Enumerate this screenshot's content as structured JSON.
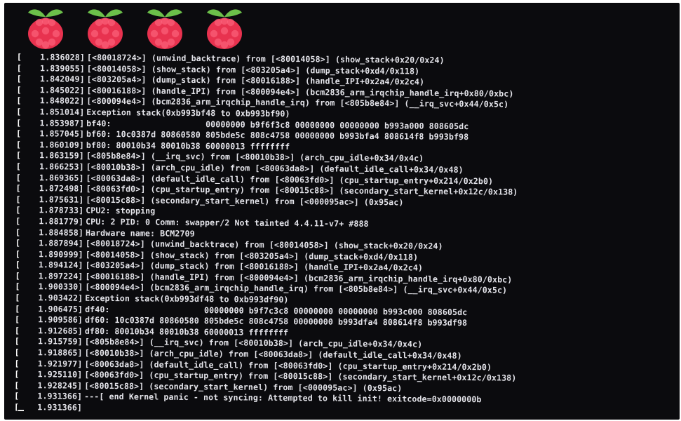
{
  "screen": {
    "background": "#0b0b0e",
    "text_color": "#e4e4ea",
    "logo_icon": "raspberry-pi-logo-icon",
    "logo_count": 4,
    "logo_colors": {
      "berry": "#e8324f",
      "leaf": "#6cc04a"
    }
  },
  "console": {
    "lines": [
      {
        "bracket": "[",
        "ts": "1.836028]",
        "msg": "[<80018724>] (unwind_backtrace) from [<80014058>] (show_stack+0x20/0x24)"
      },
      {
        "bracket": "[",
        "ts": "1.839055]",
        "msg": "[<80014058>] (show_stack) from [<803205a4>] (dump_stack+0xd4/0x118)"
      },
      {
        "bracket": "[",
        "ts": "1.842049]",
        "msg": "[<803205a4>] (dump_stack) from [<80016188>] (handle_IPI+0x2a4/0x2c4)"
      },
      {
        "bracket": "[",
        "ts": "1.845022]",
        "msg": "[<80016188>] (handle_IPI) from [<800094e4>] (bcm2836_arm_irqchip_handle_irq+0x80/0xbc)"
      },
      {
        "bracket": "[",
        "ts": "1.848022]",
        "msg": "[<800094e4>] (bcm2836_arm_irqchip_handle_irq) from [<805b8e84>] (__irq_svc+0x44/0x5c)"
      },
      {
        "bracket": "[",
        "ts": "1.851014]",
        "msg": "Exception stack(0xb993bf48 to 0xb993bf90)"
      },
      {
        "bracket": "[",
        "ts": "1.853987]",
        "msg": "bf40:                   00000000 b9f6f3c8 00000000 00000000 b993a000 808605dc"
      },
      {
        "bracket": "[",
        "ts": "1.857045]",
        "msg": "bf60: 10c0387d 80860580 805bde5c 808c4758 00000000 b993bfa4 808614f8 b993bf98"
      },
      {
        "bracket": "[",
        "ts": "1.860109]",
        "msg": "bf80: 80010b34 80010b38 60000013 ffffffff"
      },
      {
        "bracket": "[",
        "ts": "1.863159]",
        "msg": "[<805b8e84>] (__irq_svc) from [<80010b38>] (arch_cpu_idle+0x34/0x4c)"
      },
      {
        "bracket": "[",
        "ts": "1.866253]",
        "msg": "[<80010b38>] (arch_cpu_idle) from [<80063da8>] (default_idle_call+0x34/0x48)"
      },
      {
        "bracket": "[",
        "ts": "1.869365]",
        "msg": "[<80063da8>] (default_idle_call) from [<80063fd0>] (cpu_startup_entry+0x214/0x2b0)"
      },
      {
        "bracket": "[",
        "ts": "1.872498]",
        "msg": "[<80063fd0>] (cpu_startup_entry) from [<80015c88>] (secondary_start_kernel+0x12c/0x138)"
      },
      {
        "bracket": "[",
        "ts": "1.875631]",
        "msg": "[<80015c88>] (secondary_start_kernel) from [<000095ac>] (0x95ac)"
      },
      {
        "bracket": "[",
        "ts": "1.878733]",
        "msg": "CPU2: stopping"
      },
      {
        "bracket": "[",
        "ts": "1.881779]",
        "msg": "CPU: 2 PID: 0 Comm: swapper/2 Not tainted 4.4.11-v7+ #888"
      },
      {
        "bracket": "[",
        "ts": "1.884858]",
        "msg": "Hardware name: BCM2709"
      },
      {
        "bracket": "[",
        "ts": "1.887894]",
        "msg": "[<80018724>] (unwind_backtrace) from [<80014058>] (show_stack+0x20/0x24)"
      },
      {
        "bracket": "[",
        "ts": "1.890999]",
        "msg": "[<80014058>] (show_stack) from [<803205a4>] (dump_stack+0xd4/0x118)"
      },
      {
        "bracket": "[",
        "ts": "1.894124]",
        "msg": "[<803205a4>] (dump_stack) from [<80016188>] (handle_IPI+0x2a4/0x2c4)"
      },
      {
        "bracket": "[",
        "ts": "1.897224]",
        "msg": "[<80016188>] (handle_IPI) from [<800094e4>] (bcm2836_arm_irqchip_handle_irq+0x80/0xbc)"
      },
      {
        "bracket": "[",
        "ts": "1.900330]",
        "msg": "[<800094e4>] (bcm2836_arm_irqchip_handle_irq) from [<805b8e84>] (__irq_svc+0x44/0x5c)"
      },
      {
        "bracket": "[",
        "ts": "1.903422]",
        "msg": "Exception stack(0xb993df48 to 0xb993df90)"
      },
      {
        "bracket": "[",
        "ts": "1.906475]",
        "msg": "df40:                   00000000 b9f7c3c8 00000000 00000000 b993c000 808605dc"
      },
      {
        "bracket": "[",
        "ts": "1.909586]",
        "msg": "df60: 10c0387d 80860580 805bde5c 808c4758 00000000 b993dfa4 808614f8 b993df98"
      },
      {
        "bracket": "[",
        "ts": "1.912685]",
        "msg": "df80: 80010b34 80010b38 60000013 ffffffff"
      },
      {
        "bracket": "[",
        "ts": "1.915759]",
        "msg": "[<805b8e84>] (__irq_svc) from [<80010b38>] (arch_cpu_idle+0x34/0x4c)"
      },
      {
        "bracket": "[",
        "ts": "1.918865]",
        "msg": "[<80010b38>] (arch_cpu_idle) from [<80063da8>] (default_idle_call+0x34/0x48)"
      },
      {
        "bracket": "[",
        "ts": "1.921977]",
        "msg": "[<80063da8>] (default_idle_call) from [<80063fd0>] (cpu_startup_entry+0x214/0x2b0)"
      },
      {
        "bracket": "[",
        "ts": "1.925110]",
        "msg": "[<80063fd0>] (cpu_startup_entry) from [<80015c88>] (secondary_start_kernel+0x12c/0x138)"
      },
      {
        "bracket": "[",
        "ts": "1.928245]",
        "msg": "[<80015c88>] (secondary_start_kernel) from [<000095ac>] (0x95ac)"
      },
      {
        "bracket": "[",
        "ts": "1.931366]",
        "msg": "---[ end Kernel panic - not syncing: Attempted to kill init! exitcode=0x0000000b"
      },
      {
        "bracket": "[",
        "ts": "1.931366]",
        "msg": ""
      }
    ],
    "cursor": "_"
  }
}
